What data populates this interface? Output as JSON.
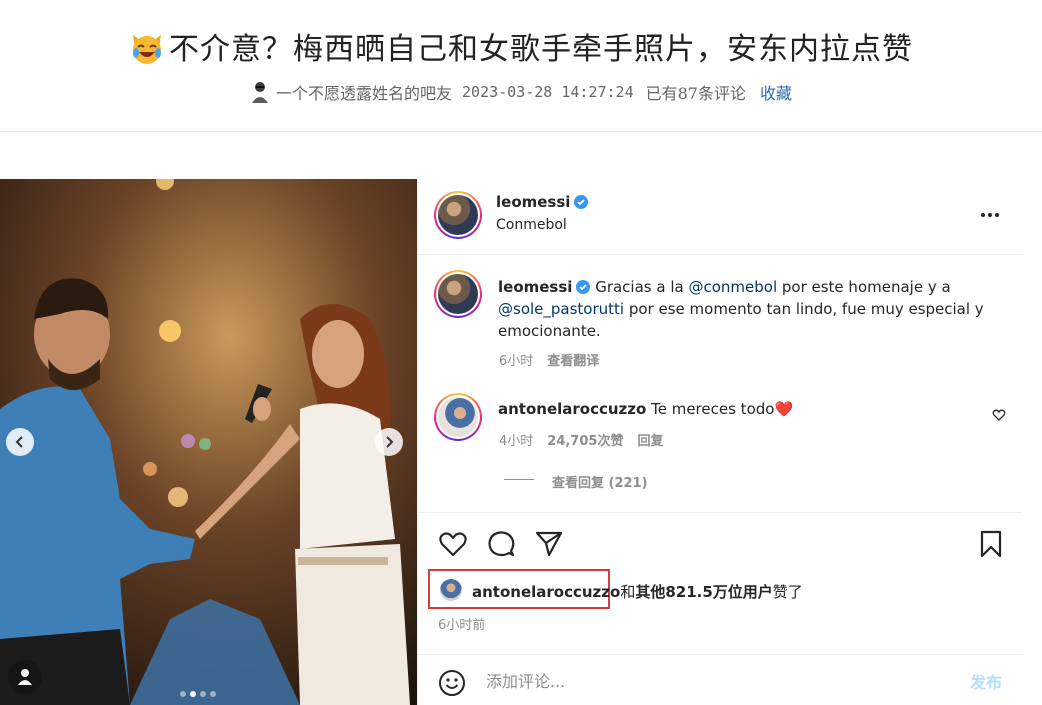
{
  "article": {
    "title": "不介意？梅西晒自己和女歌手牵手照片，安东内拉点赞",
    "author": "一个不愿透露姓名的吧友",
    "date": "2023-03-28 14:27:24",
    "comment_count": "已有87条评论",
    "favorite": "收藏"
  },
  "post": {
    "username": "leomessi",
    "location": "Conmebol",
    "caption": {
      "username": "leomessi",
      "text_1": "Gracias a la ",
      "mention_1": "@conmebol",
      "text_2": " por este homenaje y a",
      "mention_2": "@sole_pastorutti",
      "text_3": " por ese momento tan lindo, fue muy especial y emocionante.",
      "time": "6小时",
      "translate": "查看翻译"
    },
    "comment": {
      "username": "antonelaroccuzzo",
      "text": "Te mereces todo❤️",
      "time": "4小时",
      "likes": "24,705次赞",
      "reply": "回复",
      "view_replies": "查看回复 (221)"
    },
    "likes": {
      "user": "antonelaroccuzzo",
      "connector": "和",
      "rest": "其他821.5万位用户",
      "suffix": "赞了"
    },
    "time_ago": "6小时前",
    "comment_placeholder": "添加评论...",
    "post_label": "发布"
  },
  "icons": {
    "verified": "verified-badge-icon",
    "heart": "heart-icon",
    "comment": "comment-icon",
    "share": "share-icon",
    "save": "bookmark-icon",
    "emoji": "smiley-icon"
  },
  "colors": {
    "mention": "#00376b",
    "verified": "#3897f0",
    "highlight_box": "#d93b3b",
    "post_button": "#b2dffc"
  }
}
